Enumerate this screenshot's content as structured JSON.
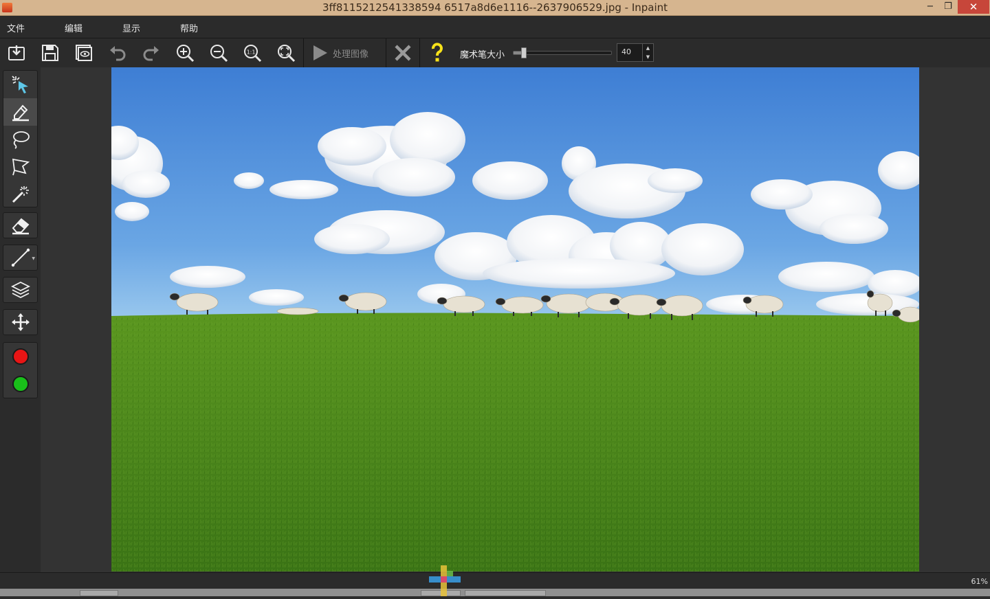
{
  "window": {
    "title": "3ff8115212541338594 6517a8d6e1116--2637906529.jpg - Inpaint",
    "minimize": "−",
    "restore": "❐",
    "close": "✕"
  },
  "menu": {
    "file": "文件",
    "edit": "编辑",
    "view": "显示",
    "help": "帮助"
  },
  "toolbar": {
    "open": "open-image-icon",
    "save": "save-icon",
    "preview": "preview-icon",
    "undo": "undo-icon",
    "redo": "redo-icon",
    "zoom_in": "zoom-in-icon",
    "zoom_out": "zoom-out-icon",
    "actual_size": "actual-size-icon",
    "fit": "fit-to-window-icon",
    "process_label": "处理图像",
    "cancel": "cancel-icon",
    "help": "help-icon",
    "brush_size_label": "魔术笔大小",
    "brush_size_value": "40",
    "brush_size_level": 0.08
  },
  "tools": [
    {
      "name": "smart-selection-tool",
      "icon": "magic-cursor-icon"
    },
    {
      "name": "marker-tool",
      "icon": "marker-icon",
      "active": true
    },
    {
      "name": "lasso-tool",
      "icon": "lasso-icon"
    },
    {
      "name": "polygonal-lasso-tool",
      "icon": "polygonal-lasso-icon"
    },
    {
      "name": "magic-wand-tool",
      "icon": "magic-wand-icon"
    },
    {
      "name": "eraser-tool",
      "icon": "eraser-icon"
    },
    {
      "name": "guide-line-tool",
      "icon": "line-icon"
    },
    {
      "name": "layers-tool",
      "icon": "layers-icon"
    },
    {
      "name": "move-tool",
      "icon": "move-icon"
    },
    {
      "name": "red-marker-color",
      "icon": "red-circle-icon",
      "color": "#e81515"
    },
    {
      "name": "green-donor-color",
      "icon": "green-circle-icon",
      "color": "#19c01a"
    }
  ],
  "colors": {
    "titlebar": "#d6b58f",
    "close_button": "#c7463a",
    "sky_top": "#3f7fd4",
    "sky_bottom": "#8fc0ea",
    "grass_top": "#4f8a1e",
    "grass_bottom": "#356f16"
  },
  "status": {
    "zoom": "61%"
  }
}
